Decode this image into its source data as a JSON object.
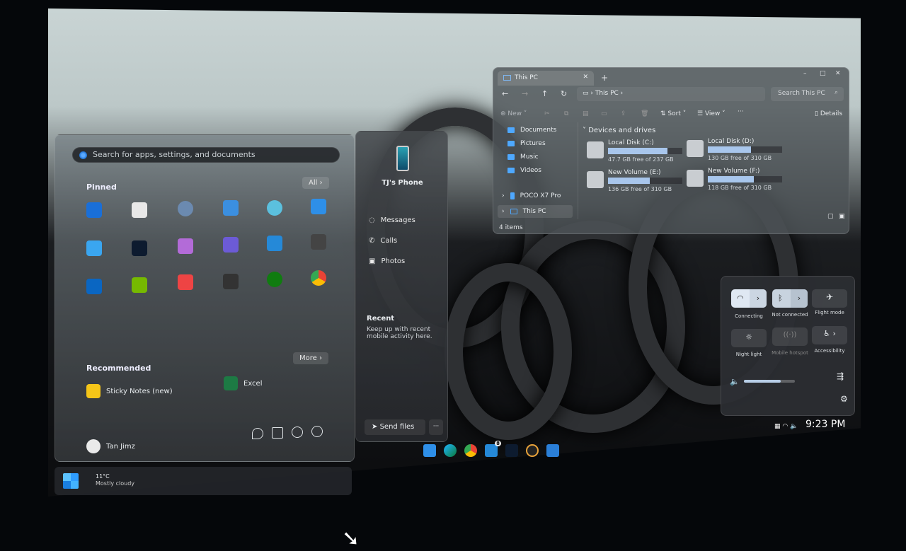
{
  "start": {
    "search_placeholder": "Search for apps, settings, and documents",
    "pinned": "Pinned",
    "all": "All",
    "recommended": "Recommended",
    "more": "More",
    "recs": [
      {
        "label": "Sticky Notes (new)"
      },
      {
        "label": "Excel"
      }
    ],
    "user": "Tan Jimz"
  },
  "phone": {
    "name": "TJ's Phone",
    "items": [
      "Messages",
      "Calls",
      "Photos"
    ],
    "recent": "Recent",
    "recent_desc": "Keep up with recent mobile activity here.",
    "send": "Send files",
    "more": "···"
  },
  "explorer": {
    "tab": "This PC",
    "new_tab": "+",
    "path": "This PC",
    "search": "Search This PC",
    "new": "New",
    "sort": "Sort",
    "view": "View",
    "details": "Details",
    "group": "Devices and drives",
    "nav": [
      "Documents",
      "Pictures",
      "Music",
      "Videos"
    ],
    "devices": [
      "POCO X7 Pro",
      "This PC"
    ],
    "items_count": "4 items",
    "drives": [
      {
        "name": "Local Disk (C:)",
        "free": "47.7 GB free of 237 GB",
        "used": 0.8
      },
      {
        "name": "Local Disk (D:)",
        "free": "130 GB free of 310 GB",
        "used": 0.58
      },
      {
        "name": "New Volume (E:)",
        "free": "136 GB free of 310 GB",
        "used": 0.56
      },
      {
        "name": "New Volume (F:)",
        "free": "118 GB free of 310 GB",
        "used": 0.62
      }
    ]
  },
  "quick": {
    "wifi": "Connecting",
    "bt": "Not connected",
    "flight": "Flight mode",
    "night": "Night light",
    "hotspot": "Mobile hotspot",
    "access": "Accessibility",
    "volume": 0.72
  },
  "taskbar": {
    "time": "9:23 PM",
    "badge": "8",
    "weather_temp": "11°C",
    "weather_desc": "Mostly cloudy"
  }
}
